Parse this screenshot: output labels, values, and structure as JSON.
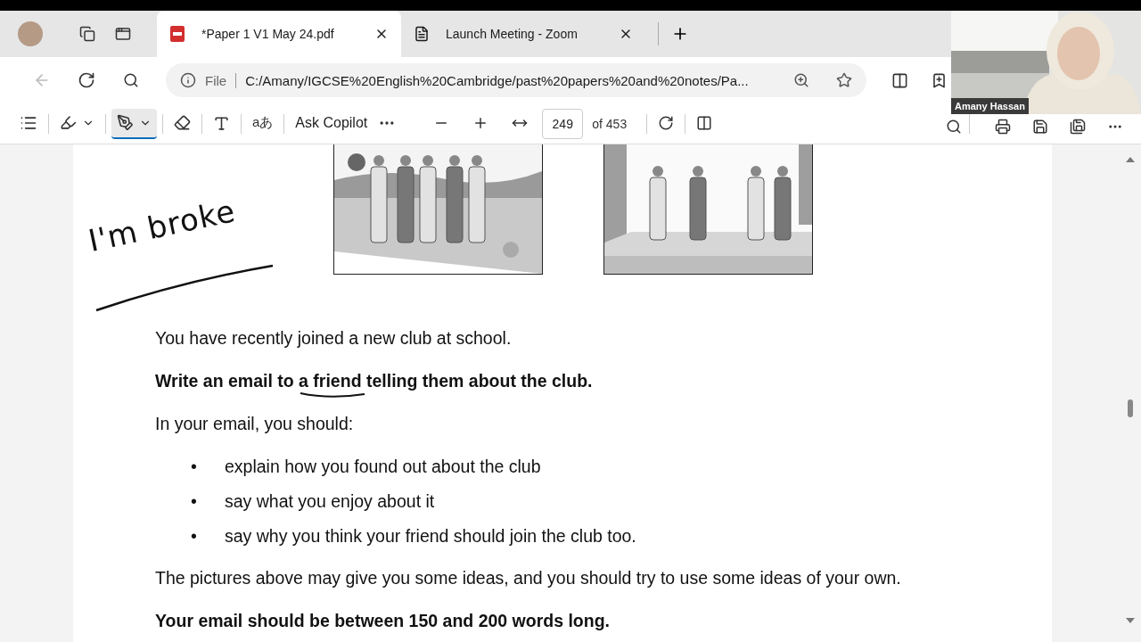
{
  "tabs": [
    {
      "title": "*Paper 1 V1 May 24.pdf",
      "kind": "pdf",
      "selected": true
    },
    {
      "title": "Launch Meeting - Zoom",
      "kind": "page",
      "selected": false
    }
  ],
  "address": {
    "scheme": "File",
    "url": "C:/Amany/IGCSE%20English%20Cambridge/past%20papers%20and%20notes/Pa..."
  },
  "pdf_toolbar": {
    "read_aloud": "aあ",
    "copilot": "Ask Copilot",
    "page": "249",
    "page_total": "of 453"
  },
  "annotation": {
    "text": "I'm broke"
  },
  "question": {
    "intro": "You have recently joined a new club at school.",
    "task": [
      {
        "text": "Write an email to ",
        "kind": "plain"
      },
      {
        "text": "a friend",
        "kind": "inked"
      },
      {
        "text": " telling them about the club.",
        "kind": "plain"
      }
    ],
    "lead": "In your email, you should:",
    "bullets": [
      {
        "mark": "•",
        "text": "explain how you found out about the club"
      },
      {
        "mark": "•",
        "text": "say what you enjoy about it"
      },
      {
        "mark": "•",
        "text": "say why you think your friend should join the club too."
      }
    ],
    "note": "The pictures above may give you some ideas, and you should try to use some ideas of your own.",
    "length": "Your email should be between 150 and 200 words long."
  },
  "video": {
    "name": "Amany Hassan"
  }
}
